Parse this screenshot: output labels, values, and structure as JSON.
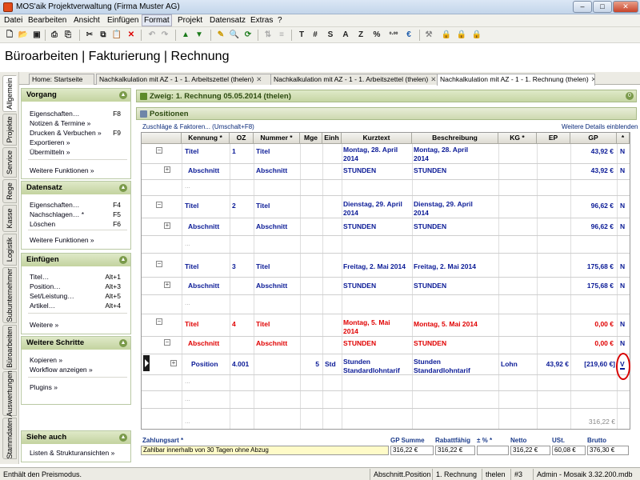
{
  "window": {
    "title": "MOS'aik Projektverwaltung (Firma Muster AG)",
    "controls": [
      "–",
      "□",
      "✕"
    ]
  },
  "menu": [
    "Datei",
    "Bearbeiten",
    "Ansicht",
    "Einfügen",
    "Format",
    "Projekt",
    "Datensatz",
    "Extras",
    "?"
  ],
  "toolbar": {
    "text_buttons": [
      "T",
      "#",
      "S",
      "A",
      "Z",
      "%"
    ]
  },
  "page_title": "Büroarbeiten | Fakturierung | Rechnung",
  "side_tabs": [
    "Allgemein",
    "Projekte",
    "Service",
    "Rege",
    "Kasse",
    "Logistik",
    "Subunternehmer",
    "Büroarbeiten",
    "Auswertungen",
    "Stammdaten"
  ],
  "doc_tabs": [
    {
      "label": "Home: Startseite",
      "close": ""
    },
    {
      "label": "Nachkalkulation mit AZ - 1 - 1. Arbeitszettel (thelen)",
      "close": "✕"
    },
    {
      "label": "Nachkalkulation mit AZ - 1 - 1. Arbeitszettel (thelen)",
      "close": "✕"
    },
    {
      "label": "Nachkalkulation mit AZ - 1 - 1. Rechnung (thelen)",
      "close": "✕"
    }
  ],
  "sidebar": {
    "vorgang": {
      "title": "Vorgang",
      "items": [
        {
          "label": "Eigenschaften…",
          "key": "F8"
        },
        {
          "label": "Notizen & Termine »",
          "key": ""
        },
        {
          "label": "Drucken & Verbuchen »",
          "key": "F9"
        },
        {
          "label": "Exportieren »",
          "key": ""
        },
        {
          "label": "Übermitteln »",
          "key": ""
        }
      ],
      "more": "Weitere Funktionen »"
    },
    "datensatz": {
      "title": "Datensatz",
      "items": [
        {
          "label": "Eigenschaften…",
          "key": "F4"
        },
        {
          "label": "Nachschlagen… *",
          "key": "F5"
        },
        {
          "label": "Löschen",
          "key": "F6"
        }
      ],
      "more": "Weitere Funktionen »"
    },
    "einfuegen": {
      "title": "Einfügen",
      "items": [
        {
          "label": "Titel…",
          "key": "Alt+1"
        },
        {
          "label": "Position…",
          "key": "Alt+3"
        },
        {
          "label": "Set/Leistung…",
          "key": "Alt+5"
        },
        {
          "label": "Artikel…",
          "key": "Alt+4"
        }
      ],
      "more": "Weitere »"
    },
    "schritte": {
      "title": "Weitere Schritte",
      "items": [
        {
          "label": "Kopieren »",
          "key": ""
        },
        {
          "label": "Workflow anzeigen »",
          "key": ""
        }
      ],
      "more": "Plugins »"
    },
    "siehe": {
      "title": "Siehe auch",
      "items": [
        {
          "label": "Listen & Strukturansichten »",
          "key": ""
        }
      ]
    }
  },
  "branch": {
    "label": "Zweig: 1. Rechnung 05.05.2014 (thelen)",
    "badge": "0"
  },
  "positions": {
    "title": "Positionen",
    "left_link": "Zuschläge & Faktoren... (Umschalt+F8)",
    "right_link": "Weitere Details einblenden",
    "columns": [
      "Kennung *",
      "OZ",
      "Nummer *",
      "Mge",
      "Einh",
      "Kurztext",
      "Beschreibung",
      "KG *",
      "EP",
      "GP",
      "*"
    ],
    "rows": [
      {
        "kennung": "Titel",
        "oz": "1",
        "nummer": "Titel",
        "kurz1": "Montag, 28. April",
        "kurz2": "2014",
        "besch1": "Montag, 28. April",
        "besch2": "2014",
        "gp": "43,92 €",
        "flag": "N",
        "color": "blue",
        "level": 0
      },
      {
        "kennung": "Abschnitt",
        "oz": "",
        "nummer": "Abschnitt",
        "kurz1": "STUNDEN",
        "kurz2": "",
        "besch1": "STUNDEN",
        "besch2": "",
        "gp": "43,92 €",
        "flag": "N",
        "color": "blue",
        "level": 1
      },
      {
        "kennung": "Titel",
        "oz": "2",
        "nummer": "Titel",
        "kurz1": "Dienstag, 29. April",
        "kurz2": "2014",
        "besch1": "Dienstag, 29. April",
        "besch2": "2014",
        "gp": "96,62 €",
        "flag": "N",
        "color": "blue",
        "level": 0
      },
      {
        "kennung": "Abschnitt",
        "oz": "",
        "nummer": "Abschnitt",
        "kurz1": "STUNDEN",
        "kurz2": "",
        "besch1": "STUNDEN",
        "besch2": "",
        "gp": "96,62 €",
        "flag": "N",
        "color": "blue",
        "level": 1
      },
      {
        "kennung": "Titel",
        "oz": "3",
        "nummer": "Titel",
        "kurz1": "Freitag, 2. Mai 2014",
        "kurz2": "",
        "besch1": "Freitag, 2. Mai 2014",
        "besch2": "",
        "gp": "175,68 €",
        "flag": "N",
        "color": "blue",
        "level": 0
      },
      {
        "kennung": "Abschnitt",
        "oz": "",
        "nummer": "Abschnitt",
        "kurz1": "STUNDEN",
        "kurz2": "",
        "besch1": "STUNDEN",
        "besch2": "",
        "gp": "175,68 €",
        "flag": "N",
        "color": "blue",
        "level": 1
      },
      {
        "kennung": "Titel",
        "oz": "4",
        "nummer": "Titel",
        "kurz1": "Montag, 5. Mai",
        "kurz2": "2014",
        "besch1": "Montag, 5. Mai 2014",
        "besch2": "",
        "gp": "0,00 €",
        "flag": "N",
        "color": "red",
        "level": 0
      },
      {
        "kennung": "Abschnitt",
        "oz": "",
        "nummer": "Abschnitt",
        "kurz1": "STUNDEN",
        "kurz2": "",
        "besch1": "STUNDEN",
        "besch2": "",
        "gp": "0,00 €",
        "flag": "N",
        "color": "red",
        "level": 1
      }
    ],
    "position_row": {
      "kennung": "Position",
      "oz": "4.001",
      "mge": "5",
      "einh": "Std",
      "kurz1": "Stunden",
      "kurz2": "Standardlohntarif",
      "besch1": "Stunden",
      "besch2": "Standardlohntarif",
      "kg": "Lohn",
      "ep": "43,92 €",
      "gp": "[219,60 €]",
      "flag": "V"
    },
    "placeholder": "...",
    "total": "316,22 €"
  },
  "footer": {
    "zahlungsart_label": "Zahlungsart *",
    "zahlungsart_value": "Zahlbar innerhalb von 30 Tagen ohne Abzug",
    "gp_summe_label": "GP Summe",
    "gp_summe": "316,22 €",
    "rabattfaehig_label": "Rabattfähig",
    "rabattfaehig": "316,22 €",
    "prozent_label": "± % *",
    "prozent": "",
    "netto_label": "Netto",
    "netto": "316,22 €",
    "ust_label": "USt.",
    "ust": "60,08 €",
    "brutto_label": "Brutto",
    "brutto": "376,30 €"
  },
  "status": {
    "hint": "Enthält den Preismodus.",
    "field": "Abschnitt.Position",
    "doc": "1. Rechnung",
    "user": "thelen",
    "num": "#3",
    "db": "Admin - Mosaik 3.32.200.mdb"
  },
  "colors": {
    "accent_green": "#c3d39f",
    "text_blue": "#0a1a96",
    "text_red": "#e00000"
  }
}
